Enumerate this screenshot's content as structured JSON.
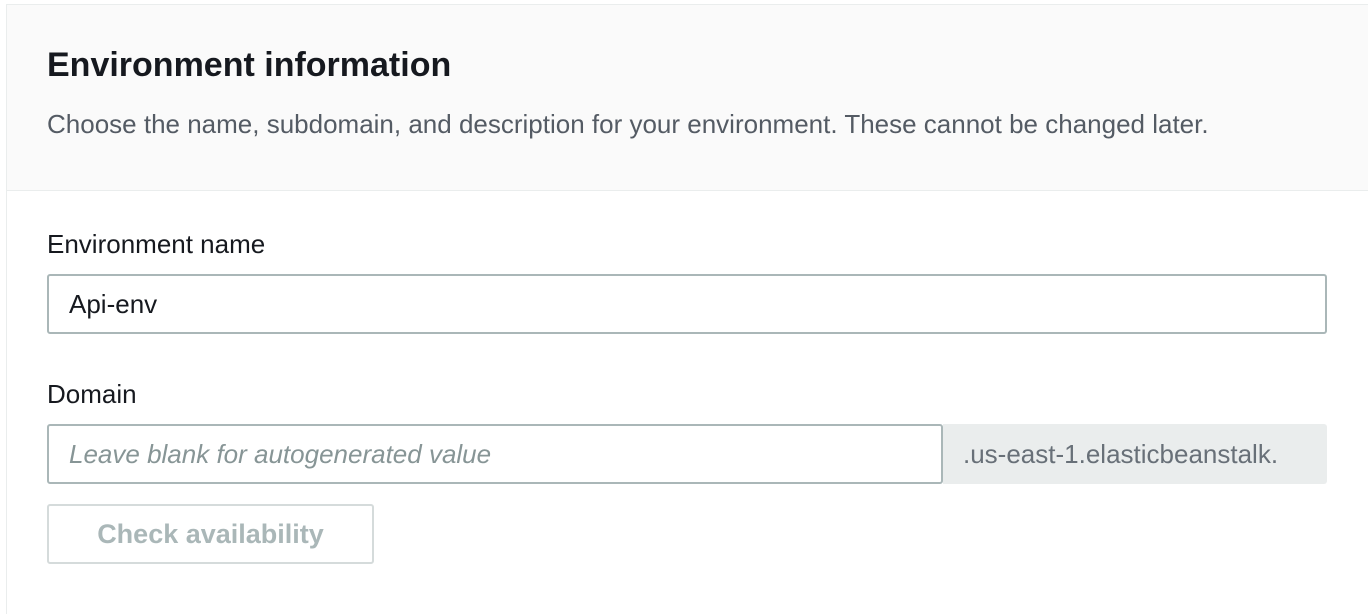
{
  "section": {
    "title": "Environment information",
    "description": "Choose the name, subdomain, and description for your environment. These cannot be changed later."
  },
  "environment_name": {
    "label": "Environment name",
    "value": "Api-env"
  },
  "domain": {
    "label": "Domain",
    "value": "",
    "placeholder": "Leave blank for autogenerated value",
    "suffix": ".us-east-1.elasticbeanstalk."
  },
  "check_button": {
    "label": "Check availability",
    "disabled": true
  },
  "colors": {
    "header_bg": "#fafafa",
    "border": "#aab7b8",
    "disabled_text": "#aab7b8",
    "suffix_bg": "#eaeded"
  }
}
